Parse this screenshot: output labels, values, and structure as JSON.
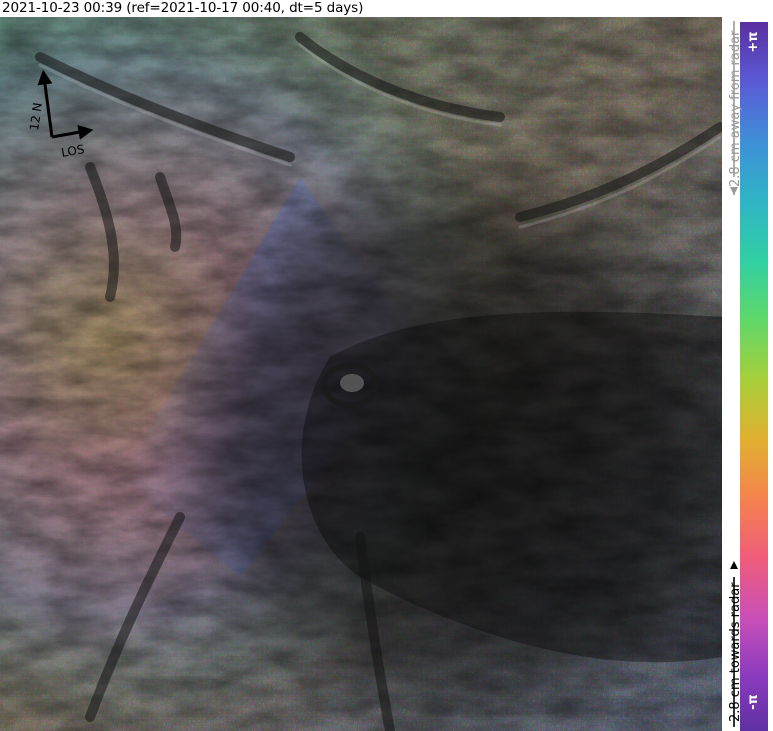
{
  "title": "2021-10-23 00:39 (ref=2021-10-17 00:40, dt=5 days)",
  "compass": {
    "north_label": "12 N",
    "los_label": "LOS"
  },
  "colorbar": {
    "top_label": "+π",
    "bottom_label": "-π",
    "away_label": "2.8 cm away from radar",
    "towards_label": "2.8 cm towards radar",
    "colors": [
      "#5a2fa0",
      "#8a3bbf",
      "#c94fb8",
      "#ef5c7a",
      "#f5834e",
      "#e0b030",
      "#a8cf3a",
      "#5fd86a",
      "#31cfa3",
      "#2fb4c6",
      "#3f8fd8",
      "#5a5ad6",
      "#5a2fa0"
    ],
    "away_color": "#999999",
    "towards_color": "#000000"
  },
  "map": {
    "description_icon": "insar-interferogram-map"
  }
}
